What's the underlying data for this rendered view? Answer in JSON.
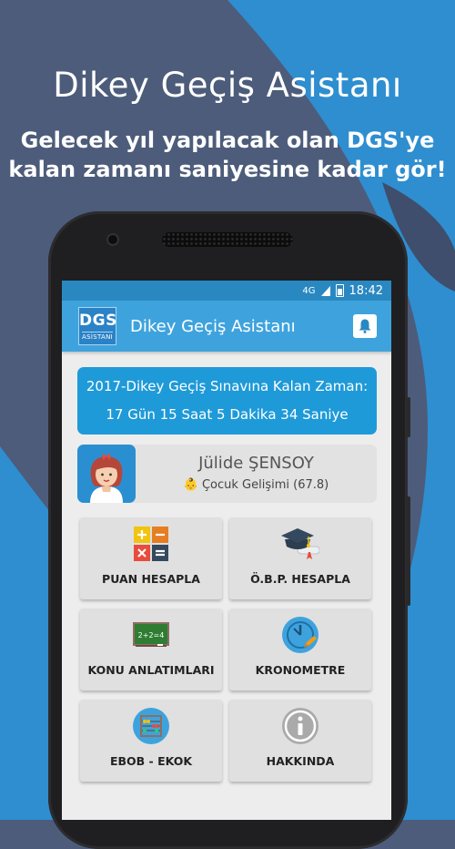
{
  "promo": {
    "headline": "Dikey Geçiş Asistanı",
    "tagline_line1": "Gelecek yıl yapılacak olan DGS'ye",
    "tagline_line2": "kalan zamanı saniyesine kadar gör!"
  },
  "status_bar": {
    "network": "4G",
    "time": "18:42"
  },
  "app_bar": {
    "logo_text": "DGS",
    "logo_subtext": "ASİSTANI",
    "title": "Dikey Geçiş Asistanı",
    "notifications_icon": "bell-icon"
  },
  "countdown": {
    "title": "2017-Dikey Geçiş Sınavına Kalan Zaman:",
    "remaining": "17 Gün 15 Saat 5 Dakika 34 Saniye"
  },
  "profile": {
    "name": "Jülide ŞENSOY",
    "department_emoji": "👶",
    "department": "Çocuk Gelişimi (67.8)"
  },
  "menu": [
    {
      "label": "PUAN HESAPLA",
      "icon": "calculator-icon"
    },
    {
      "label": "Ö.B.P. HESAPLA",
      "icon": "graduation-cap-icon"
    },
    {
      "label": "KONU ANLATIMLARI",
      "icon": "chalkboard-icon"
    },
    {
      "label": "KRONOMETRE",
      "icon": "stopwatch-icon"
    },
    {
      "label": "EBOB - EKOK",
      "icon": "abacus-icon"
    },
    {
      "label": "HAKKINDA",
      "icon": "info-icon"
    }
  ],
  "colors": {
    "background": "#4d5c7a",
    "background_shape": "#2e8ed0",
    "status_bar": "#2a88c1",
    "app_bar": "#3ea3dd",
    "countdown_card": "#1f9ad8",
    "tile": "#e0e0e0"
  }
}
